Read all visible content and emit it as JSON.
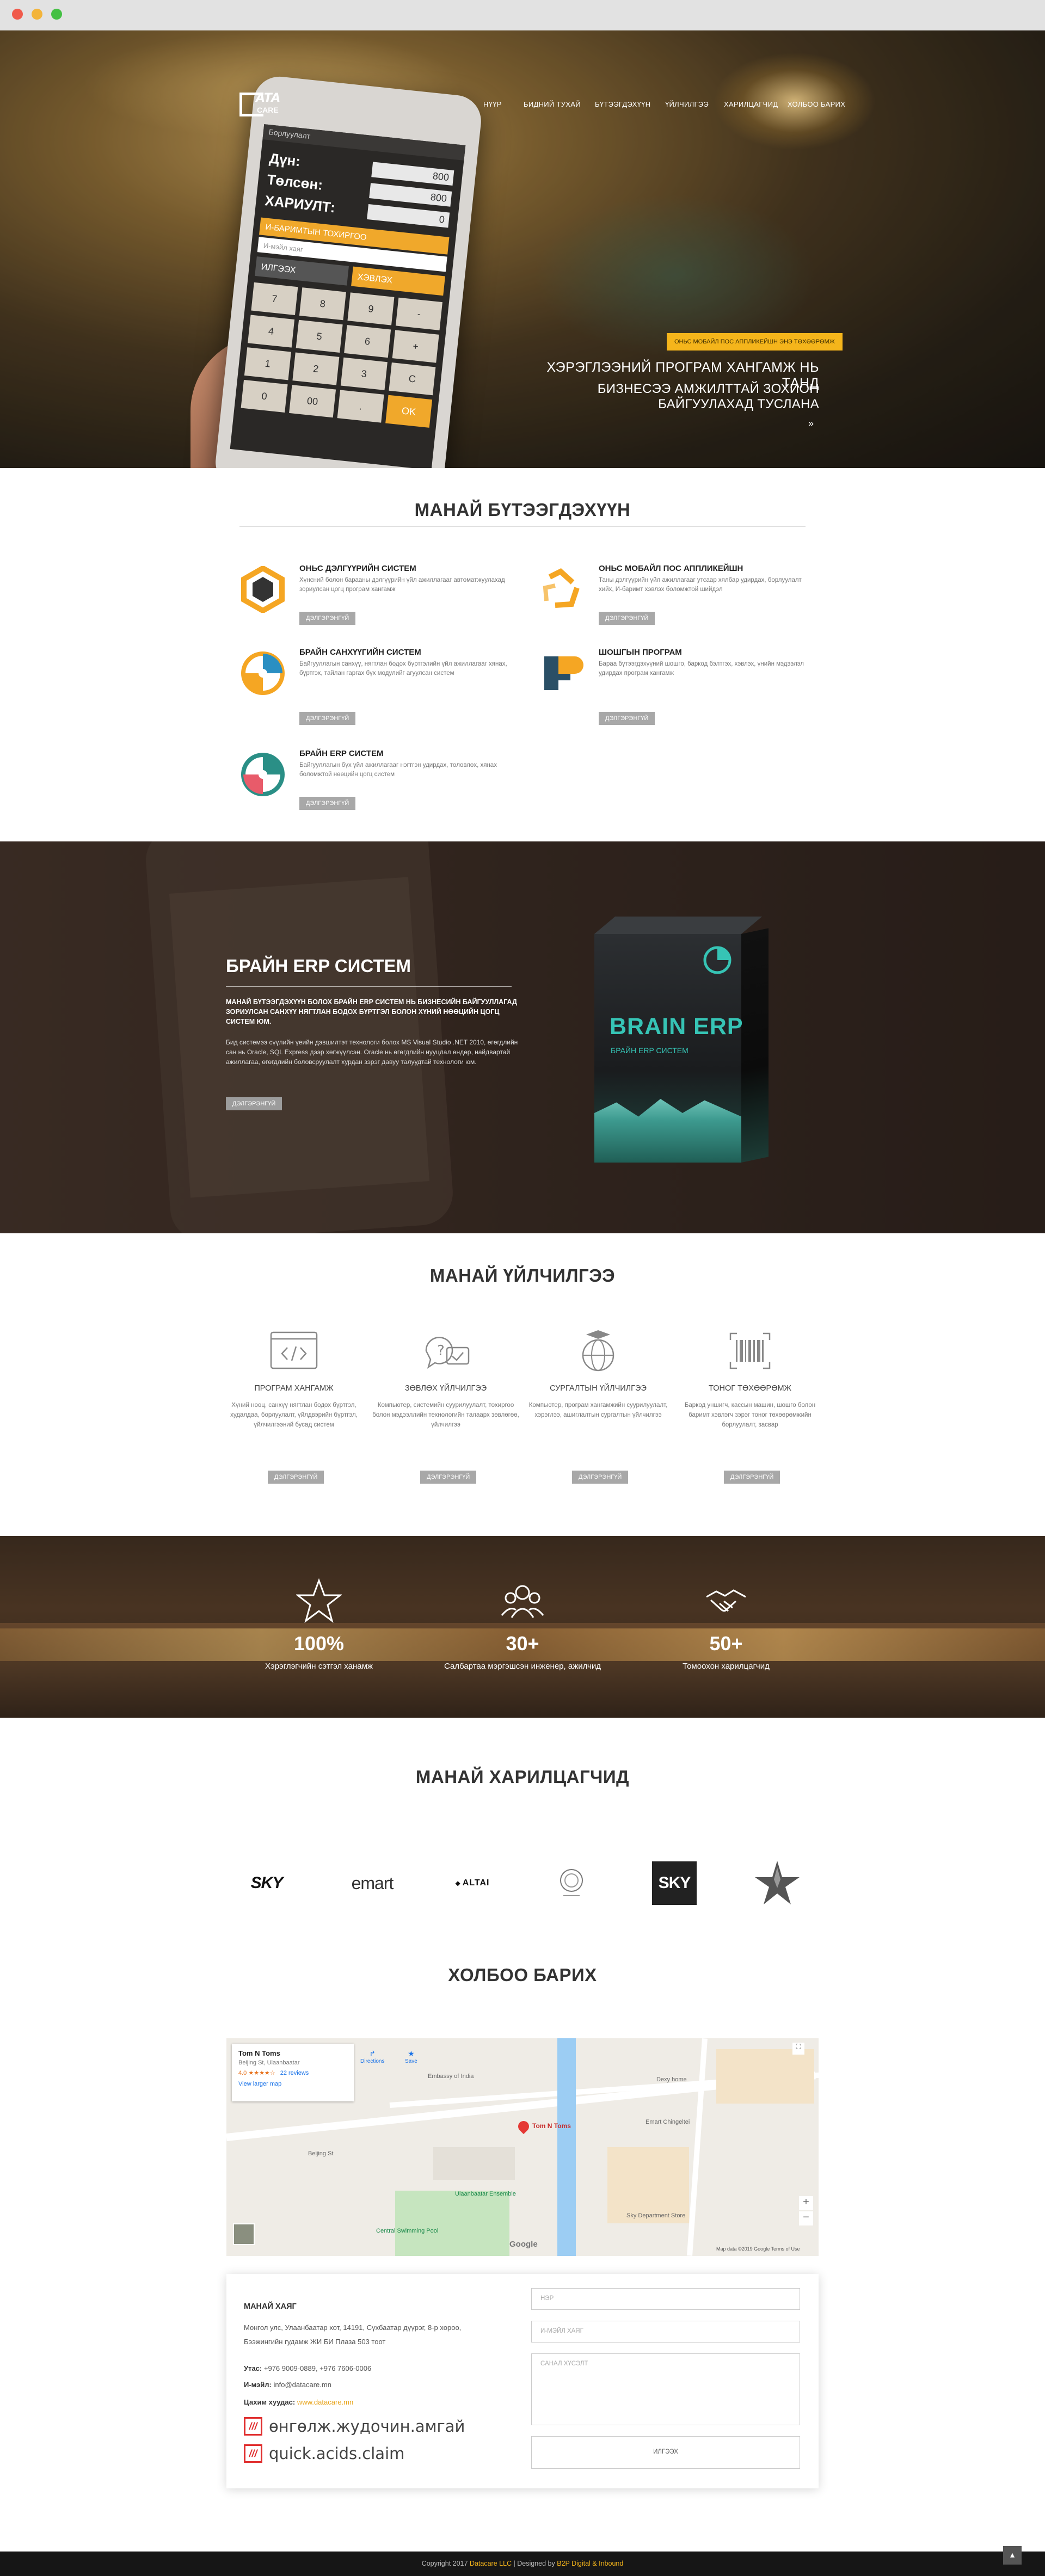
{
  "nav": {
    "logo_mark": "D",
    "logo_text": "ATA",
    "logo_sub": "CARE",
    "items": [
      "НҮҮР",
      "БИДНИЙ ТУХАЙ",
      "БҮТЭЭГДЭХҮҮН",
      "ҮЙЛЧИЛГЭЭ",
      "ХАРИЛЦАГЧИД",
      "ХОЛБОО БАРИХ"
    ]
  },
  "hero": {
    "badge": "ОНЬС МОБАЙЛ ПОС АППЛИКЕЙШН ЭНЭ ТӨХӨӨРӨМЖ",
    "line1": "ХЭРЭГЛЭЭНИЙ ПРОГРАМ ХАНГАМЖ НЬ ТАНД",
    "line2": "БИЗНЕСЭЭ АМЖИЛТТАЙ ЗОХИОН БАЙГУУЛАХАД ТУСЛАНА",
    "chevron": "»",
    "phone": {
      "bar": "Борлуулалт",
      "rows": [
        {
          "label": "Дүн:",
          "value": "800"
        },
        {
          "label": "Төлсөн:",
          "value": "800"
        },
        {
          "label": "ХАРИУЛТ:",
          "value": "0"
        }
      ],
      "receipt": "И-БАРИМТЫН ТОХИРГОО",
      "input_placeholder": "И-мэйл хаяг",
      "btn_send": "ИЛГЭЭХ",
      "btn_print": "ХЭВЛЭХ",
      "keys": [
        "7",
        "8",
        "9",
        "-",
        "4",
        "5",
        "6",
        "+",
        "1",
        "2",
        "3",
        "C",
        "0",
        "00",
        ".",
        "OK"
      ]
    }
  },
  "products": {
    "title": "МАНАЙ БҮТЭЭГДЭХҮҮН",
    "more_label": "ДЭЛГЭРЭНГҮЙ",
    "items": [
      {
        "title": "ОНЬС ДЭЛГҮҮРИЙН СИСТЕМ",
        "desc": "Хүнсний болон барааны дэлгүүрийн үйл ажиллагааг автоматжуулахад зориулсан цогц програм хангамж",
        "icon": "onys-store-icon"
      },
      {
        "title": "ОНЬС МОБАЙЛ ПОС АППЛИКЕЙШН",
        "desc": "Таны дэлгүүрийн үйл ажиллагааг утсаар хялбар удирдах, борлуулалт хийх, И-баримт хэвлэх боломжтой шийдэл",
        "icon": "onys-mobile-icon"
      },
      {
        "title": "БРАЙН САНХҮҮГИЙН СИСТЕМ",
        "desc": "Байгууллагын санхүү, нягтлан бодох бүртгэлийн үйл ажиллагааг хянах, бүртгэх, тайлан гаргах бүх модулийг агуулсан систем",
        "icon": "brain-finance-icon"
      },
      {
        "title": "ШОШГЫН ПРОГРАМ",
        "desc": "Бараа бүтээгдэхүүний шошго, баркод бэлтгэх, хэвлэх, үнийн мэдээлэл удирдах програм хангамж",
        "icon": "label-program-icon"
      },
      {
        "title": "БРАЙН ERP СИСТЕМ",
        "desc": "Байгууллагын бүх үйл ажиллагааг нэгтгэн удирдах, төлөвлөх, хянах боломжтой нөөцийн цогц систем",
        "icon": "brain-erp-icon"
      }
    ]
  },
  "erp": {
    "title": "БРАЙН ERP СИСТЕМ",
    "subtitle": "МАНАЙ БҮТЭЭГДЭХҮҮН БОЛОХ БРАЙН ERP СИСТЕМ НЬ БИЗНЕСИЙН БАЙГУУЛЛАГАД ЗОРИУЛСАН САНХҮҮ НЯГТЛАН БОДОХ БҮРТГЭЛ БОЛОН ХҮНИЙ НӨӨЦИЙН ЦОГЦ СИСТЕМ ЮМ.",
    "desc": "Бид системээ сүүлийн үеийн дэвшилтэт технологи болох MS Visual Studio .NET 2010, өгөгдлийн сан нь Oracle, SQL Express дээр хөгжүүлсэн. Oracle нь өгөгдлийн нууцлал өндөр, найдвартай ажиллагаа, өгөгдлийн боловсруулалт хурдан зэрэг давуу талуудтай технологи юм.",
    "button": "ДЭЛГЭРЭНГҮЙ",
    "box_title": "BRAIN ERP",
    "box_sub": "БРАЙН ERP СИСТЕМ"
  },
  "services": {
    "title": "МАНАЙ ҮЙЛЧИЛГЭЭ",
    "more_label": "ДЭЛГЭРЭНГҮЙ",
    "items": [
      {
        "title": "ПРОГРАМ ХАНГАМЖ",
        "desc": "Хүний нөөц, санхүү нягтлан бодох бүртгэл, худалдаа, борлуулалт, үйлдвэрийн бүртгэл, үйлчилгээний бусад систем",
        "icon": "code-window-icon"
      },
      {
        "title": "ЗӨВЛӨХ ҮЙЛЧИЛГЭЭ",
        "desc": "Компьютер, системийн суурилуулалт, тохиргоо болон мэдээллийн технологийн талаарх зөвлөгөө, үйлчилгээ",
        "icon": "consulting-chat-icon"
      },
      {
        "title": "СУРГАЛТЫН ҮЙЛЧИЛГЭЭ",
        "desc": "Компьютер, програм хангамжийн суурилуулалт, хэрэглээ, ашиглалтын сургалтын үйлчилгээ",
        "icon": "training-globe-icon"
      },
      {
        "title": "ТОНОГ ТӨХӨӨРӨМЖ",
        "desc": "Баркод уншигч, кассын машин, шошго болон баримт хэвлэгч зэрэг тоног төхөөрөмжийн борлуулалт, засвар",
        "icon": "barcode-scanner-icon"
      }
    ]
  },
  "stats": [
    {
      "number": "100%",
      "label": "Хэрэглэгчийн сэтгэл ханамж",
      "icon": "star-outline-icon"
    },
    {
      "number": "30+",
      "label": "Салбартаа мэргэшсэн инженер, ажилчид",
      "icon": "team-icon"
    },
    {
      "number": "50+",
      "label": "Томоохон харилцагчид",
      "icon": "handshake-icon"
    }
  ],
  "clients": {
    "title": "МАНАЙ ХАРИЛЦАГЧИД",
    "items": [
      "SKY",
      "emart",
      "ALTAI",
      "emblem",
      "SKY",
      "star"
    ]
  },
  "contact": {
    "title": "ХОЛБОО БАРИХ",
    "map": {
      "place": "Tom N Toms",
      "place_sub": "Beijing St, Ulaanbaatar",
      "rating": "4.0 ★★★★☆",
      "reviews": "22 reviews",
      "larger": "View larger map",
      "directions": "Directions",
      "save": "Save",
      "marker_label": "Tom N Toms",
      "labels": [
        "Beijing St",
        "Ulaanbaatar Ensemble",
        "Emart Chingeltei",
        "Sky Department Store",
        "Central Swimming Pool",
        "Dexy home",
        "Embassy of India"
      ],
      "google": "Google",
      "terms": "Map data ©2019 Google   Terms of Use"
    },
    "address_title": "МАНАЙ ХАЯГ",
    "address": "Монгол улс, Улаанбаатар хот, 14191, Сүхбаатар дүүрэг, 8-р хороо, Бээжингийн гудамж ЖИ БИ Плаза 503 тоот",
    "phone_label": "Утас:",
    "phone": "+976 9009-0889, +976 7606-0006",
    "email_label": "И-мэйл:",
    "email": "info@datacare.mn",
    "web_label": "Цахим хуудас:",
    "web": "www.datacare.mn",
    "w3w_mark": "///",
    "what3words": [
      "өнгөлж.жудочин.амгай",
      "quick.acids.claim"
    ],
    "form": {
      "name": "НЭР",
      "email": "И-МЭЙЛ ХАЯГ",
      "message": "САНАЛ ХҮСЭЛТ",
      "submit": "ИЛГЭЭХ"
    }
  },
  "footer": {
    "text1": "Copyright 2017 ",
    "brand": "Datacare LLC",
    "text2": " | Designed by ",
    "designer": "B2P Digital & Inbound"
  },
  "to_top": "▲"
}
